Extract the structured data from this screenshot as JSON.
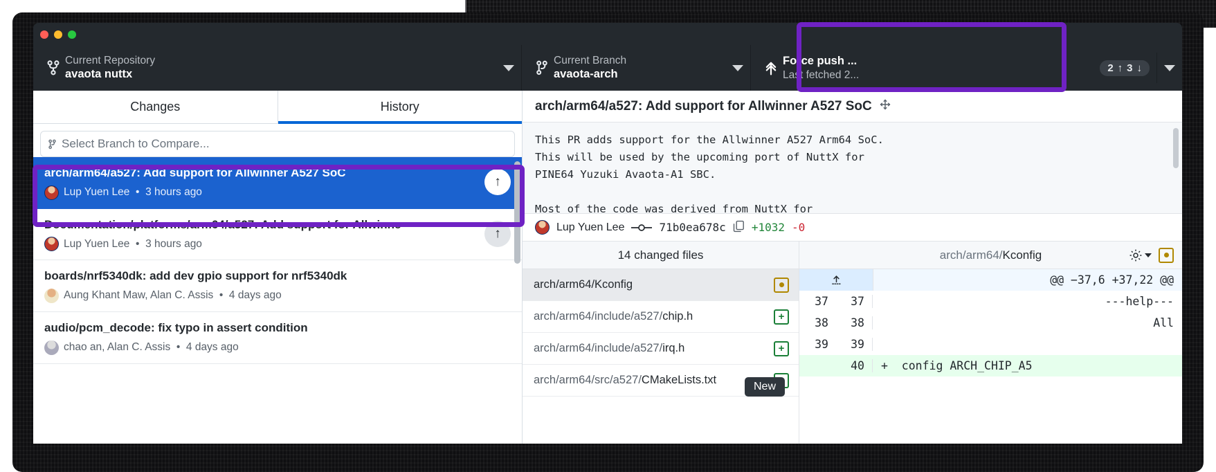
{
  "window": {
    "traffic_lights": [
      "close",
      "minimize",
      "zoom"
    ]
  },
  "toolbar": {
    "repo": {
      "label": "Current Repository",
      "value": "avaota nuttx",
      "icon": "repo-branch-icon"
    },
    "branch": {
      "label": "Current Branch",
      "value": "avaota-arch",
      "icon": "branch-icon"
    },
    "push": {
      "label": "Force push ...",
      "sub": "Last fetched 2...",
      "icon": "force-push-icon",
      "ahead": "2",
      "ahead_arrow": "↑",
      "behind": "3",
      "behind_arrow": "↓"
    }
  },
  "tabs": [
    {
      "label": "Changes",
      "active": false
    },
    {
      "label": "History",
      "active": true
    }
  ],
  "compare": {
    "placeholder": "Select Branch to Compare...",
    "icon": "branch-compare-icon"
  },
  "commits": [
    {
      "title": "arch/arm64/a527: Add support for Allwinner A527 SoC",
      "author": "Lup Yuen Lee",
      "time": "3 hours ago",
      "selected": true,
      "action_icon": "↑"
    },
    {
      "title": "Documentation/platforms/arm64/a527: Add support for Allwinne",
      "author": "Lup Yuen Lee",
      "time": "3 hours ago",
      "selected": false,
      "action_icon": "↑"
    },
    {
      "title": "boards/nrf5340dk: add dev gpio support for nrf5340dk",
      "author": "Aung Khant Maw, Alan C. Assis",
      "time": "4 days ago",
      "selected": false,
      "action_icon": ""
    },
    {
      "title": "audio/pcm_decode: fix typo in assert condition",
      "author": "chao an, Alan C. Assis",
      "time": "4 days ago",
      "selected": false,
      "action_icon": ""
    }
  ],
  "detail": {
    "title": "arch/arm64/a527: Add support for Allwinner A527 SoC",
    "drag_icon": "drag-handle-icon",
    "description": "This PR adds support for the Allwinner A527 Arm64 SoC.\nThis will be used by the upcoming port of NuttX for\nPINE64 Yuzuki Avaota-A1 SBC.\n\nMost of the code was derived from NuttX for",
    "author": "Lup Yuen Lee",
    "commit_icon": "git-commit-icon",
    "sha": "71b0ea678c",
    "copy_icon": "copy-icon",
    "additions": "+1032",
    "deletions": "-0"
  },
  "files": {
    "header": "14 changed files",
    "rows": [
      {
        "dir": "",
        "name": "arch/arm64/Kconfig",
        "status": "modified",
        "status_glyph": "●",
        "selected": true
      },
      {
        "dir": "arch/arm64/include/a527/",
        "name": "chip.h",
        "status": "new",
        "status_glyph": "+",
        "selected": false
      },
      {
        "dir": "arch/arm64/include/a527/",
        "name": "irq.h",
        "status": "new",
        "status_glyph": "+",
        "selected": false
      },
      {
        "dir": "arch/arm64/src/a527/",
        "name": "CMakeLists.txt",
        "status": "new",
        "status_glyph": "+",
        "selected": false
      }
    ]
  },
  "diff": {
    "file_dir": "arch/arm64/",
    "file_name": "Kconfig",
    "gear_icon": "gear-icon",
    "gear_caret": "chevron-down-icon",
    "header_status_glyph": "●",
    "expand_icon": "expand-up-icon",
    "hunk_header": "@@ −37,6 +37,22 @@",
    "lines": [
      {
        "old": "37",
        "new": "37",
        "type": "context",
        "text": "---help---"
      },
      {
        "old": "38",
        "new": "38",
        "type": "context",
        "text": "All"
      },
      {
        "old": "39",
        "new": "39",
        "type": "context",
        "text": ""
      },
      {
        "old": "",
        "new": "40",
        "type": "added",
        "text": "+  config ARCH_CHIP_A5"
      }
    ]
  },
  "tooltip": {
    "text": "New"
  },
  "colors": {
    "accent_blue": "#0366d6",
    "selection_blue": "#1b62cf",
    "highlight_purple": "#6f22c4",
    "toolbar_dark": "#24292e",
    "added_green": "#22863a",
    "deleted_red": "#cb2431",
    "modified_amber": "#b08800"
  }
}
